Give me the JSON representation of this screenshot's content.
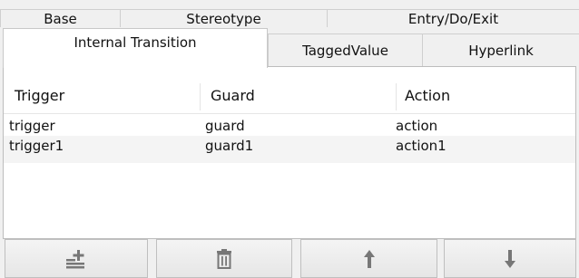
{
  "tabs_back": [
    {
      "label": "Base"
    },
    {
      "label": "Stereotype"
    },
    {
      "label": "Entry/Do/Exit"
    }
  ],
  "tabs_front": [
    {
      "label": "Internal Transition",
      "selected": true
    },
    {
      "label": "TaggedValue"
    },
    {
      "label": "Hyperlink"
    }
  ],
  "table": {
    "columns": [
      "Trigger",
      "Guard",
      "Action"
    ],
    "rows": [
      [
        "trigger",
        "guard",
        "action"
      ],
      [
        "trigger1",
        "guard1",
        "action1"
      ]
    ]
  },
  "toolbar": {
    "buttons": [
      {
        "icon": "add-row-icon"
      },
      {
        "icon": "trash-icon"
      },
      {
        "icon": "arrow-up-icon"
      },
      {
        "icon": "arrow-down-icon"
      }
    ]
  },
  "colors": {
    "panel_bg": "#ffffff",
    "window_bg": "#f0f0f0",
    "icon": "#777777"
  }
}
